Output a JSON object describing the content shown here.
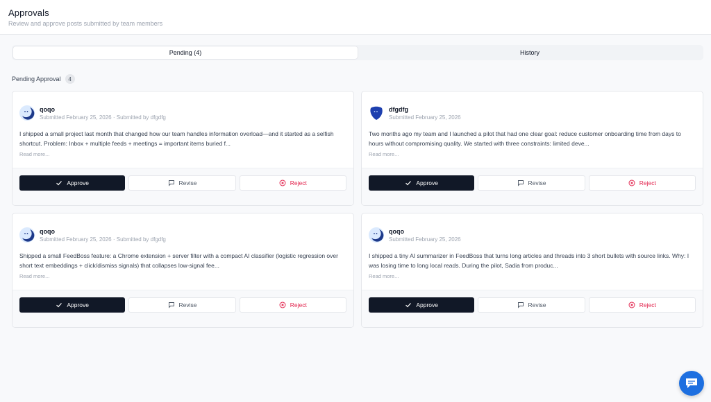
{
  "header": {
    "title": "Approvals",
    "subtitle": "Review and approve posts submitted by team members"
  },
  "tabs": [
    {
      "label": "Pending (4)",
      "active": true
    },
    {
      "label": "History",
      "active": false
    }
  ],
  "section": {
    "title": "Pending Approval",
    "count": "4"
  },
  "colors": {
    "approve_bg": "#111827",
    "reject_text": "#e11d48",
    "chat_fab": "#1d6fe0"
  },
  "cards": [
    {
      "author": "qoqo",
      "meta": "Submitted February 25, 2026 · Submitted by dfgdfg",
      "body": "I shipped a small project last month that changed how our team handles information overload—and it started as a selfish shortcut. Problem: Inbox + multiple feeds + meetings = important items buried f...",
      "read_more": "Read more...",
      "avatar": "light-moon-avatar",
      "approve": "Approve",
      "revise": "Revise",
      "reject": "Reject"
    },
    {
      "author": "dfgdfg",
      "meta": "Submitted February 25, 2026",
      "body": "Two months ago my team and I launched a pilot that had one clear goal: reduce customer onboarding time from days to hours without compromising quality. We started with three constraints: limited deve...",
      "read_more": "Read more...",
      "avatar": "dark-blob-avatar",
      "approve": "Approve",
      "revise": "Revise",
      "reject": "Reject"
    },
    {
      "author": "qoqo",
      "meta": "Submitted February 25, 2026 · Submitted by dfgdfg",
      "body": "Shipped a small FeedBoss feature: a Chrome extension + server filter with a compact AI classifier (logistic regression over short text embeddings + click/dismiss signals) that collapses low-signal fee...",
      "read_more": "Read more...",
      "avatar": "light-moon-avatar",
      "approve": "Approve",
      "revise": "Revise",
      "reject": "Reject"
    },
    {
      "author": "qoqo",
      "meta": "Submitted February 25, 2026",
      "body": "I shipped a tiny AI summarizer in FeedBoss that turns long articles and threads into 3 short bullets with source links. Why: I was losing time to long local reads. During the pilot, Sadia from produc...",
      "read_more": "Read more...",
      "avatar": "light-moon-avatar",
      "approve": "Approve",
      "revise": "Revise",
      "reject": "Reject"
    }
  ]
}
